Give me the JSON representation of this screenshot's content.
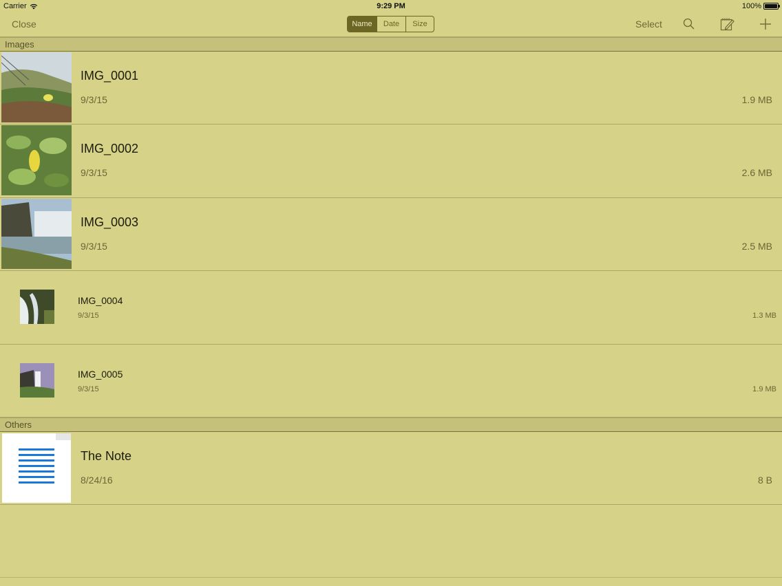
{
  "status_bar": {
    "carrier": "Carrier",
    "time": "9:29 PM",
    "battery": "100%"
  },
  "nav": {
    "close_label": "Close",
    "sort_options": [
      "Name",
      "Date",
      "Size"
    ],
    "active_sort": "Name",
    "select_label": "Select",
    "icons": [
      "search-icon",
      "compose-icon",
      "add-icon"
    ]
  },
  "sections": {
    "images_title": "Images",
    "others_title": "Others"
  },
  "images": [
    {
      "name": "IMG_0001",
      "date": "9/3/15",
      "size": "1.9 MB"
    },
    {
      "name": "IMG_0002",
      "date": "9/3/15",
      "size": "2.6 MB"
    },
    {
      "name": "IMG_0003",
      "date": "9/3/15",
      "size": "2.5 MB"
    },
    {
      "name": "IMG_0004",
      "date": "9/3/15",
      "size": "1.3 MB"
    },
    {
      "name": "IMG_0005",
      "date": "9/3/15",
      "size": "1.9 MB"
    }
  ],
  "others": [
    {
      "name": "The Note",
      "date": "8/24/16",
      "size": "8 B"
    }
  ],
  "colors": {
    "background": "#d6d388",
    "accent": "#6b6624",
    "doc_lines": "#1a78d8"
  }
}
